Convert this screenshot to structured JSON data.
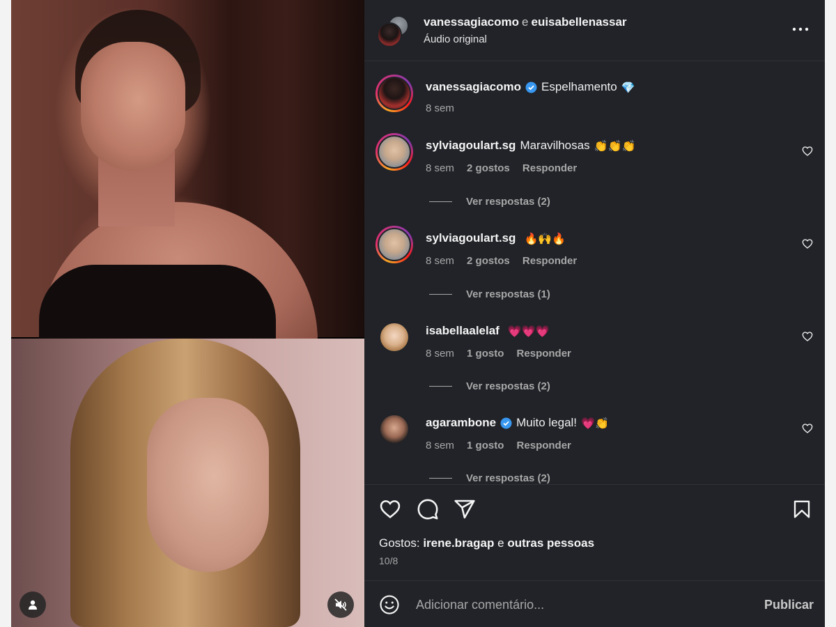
{
  "header": {
    "user1": "vanessagiacomo",
    "connector": "e",
    "user2": "euisabellenassar",
    "subtitle": "Áudio original",
    "more_icon": "more-horizontal-icon"
  },
  "comments": [
    {
      "username": "vanessagiacomo",
      "verified": true,
      "text": "Espelhamento",
      "emoji": "💎",
      "time": "8 sem"
    },
    {
      "username": "sylviagoulart.sg",
      "verified": false,
      "text": "Maravilhosas",
      "emoji": "👏👏👏",
      "time": "8 sem",
      "likes": "2 gostos",
      "reply": "Responder",
      "view_replies": "Ver respostas (2)"
    },
    {
      "username": "sylviagoulart.sg",
      "verified": false,
      "text": "",
      "emoji": "🔥🙌🔥",
      "time": "8 sem",
      "likes": "2 gostos",
      "reply": "Responder",
      "view_replies": "Ver respostas (1)"
    },
    {
      "username": "isabellaalelaf",
      "verified": false,
      "text": "",
      "emoji": "💗💗💗",
      "time": "8 sem",
      "likes": "1 gosto",
      "reply": "Responder",
      "view_replies": "Ver respostas (2)"
    },
    {
      "username": "agarambone",
      "verified": true,
      "text": "Muito legal!",
      "emoji": "💗👏",
      "time": "8 sem",
      "likes": "1 gosto",
      "reply": "Responder",
      "view_replies": "Ver respostas (2)"
    }
  ],
  "actions": {
    "likes_prefix": "Gostos:",
    "likes_user": "irene.bragap",
    "likes_connector": "e",
    "likes_others": "outras pessoas",
    "date": "10/8"
  },
  "composer": {
    "placeholder": "Adicionar comentário...",
    "publish_label": "Publicar"
  },
  "colors": {
    "panel_bg": "#212328",
    "verified_blue": "#3897f0",
    "text_secondary": "#a8a8a8"
  }
}
